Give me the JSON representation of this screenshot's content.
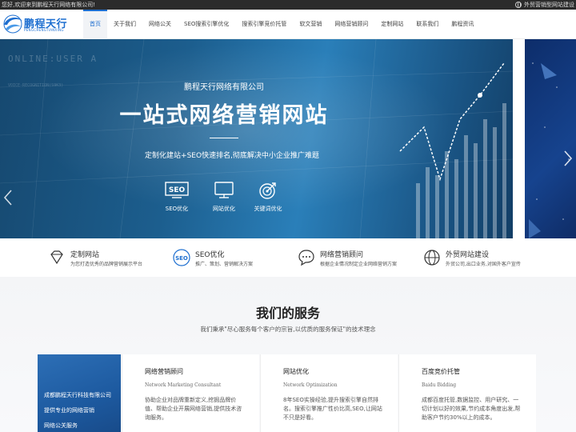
{
  "topbar": {
    "welcome": "您好,欢迎来到鹏程天行网络有限公司!",
    "right_link": "外贸营销型网站建设"
  },
  "logo": {
    "name": "鹏程天行",
    "sub": "PENGCHENGTIANXING"
  },
  "nav": {
    "items": [
      "首页",
      "关于我们",
      "网络公关",
      "SEO搜索引擎优化",
      "搜索引擎竞价托管",
      "软文营销",
      "网络营销顾问",
      "定制网站",
      "联系我们",
      "鹏程资讯"
    ],
    "active_index": 0
  },
  "banner": {
    "ghost_text": "ONLINE:USER A",
    "ghost_small": "VOICE-RECOGNITION(S9K3)",
    "company": "鹏程天行网络有限公司",
    "headline": "一站式网络营销网站",
    "tagline": "定制化建站+SEO快速排名,彻底解决中小企业推广难题",
    "features": [
      {
        "icon": "seo-icon",
        "label": "SEO优化"
      },
      {
        "icon": "monitor-icon",
        "label": "网站优化"
      },
      {
        "icon": "target-icon",
        "label": "关键词优化"
      }
    ],
    "slide_count": 2,
    "active_slide": 0
  },
  "features": [
    {
      "icon": "diamond-icon",
      "title": "定制网站",
      "desc": "为您打造优秀的品牌营销展示平台"
    },
    {
      "icon": "seo-icon",
      "title": "SEO优化",
      "desc": "推广、策划、营销解决方案"
    },
    {
      "icon": "chat-icon",
      "title": "网络营销顾问",
      "desc": "根据企业情况制定企业网络营销方案"
    },
    {
      "icon": "globe-icon",
      "title": "外贸网站建设",
      "desc": "外贸公司,出口业务,对国外客户宣传"
    }
  ],
  "services": {
    "title": "我们的服务",
    "subtitle": "我们秉承\"尽心服务每个客户的宗旨,以优质的服务保证\"的技术理念",
    "left_lines": [
      "成都鹏程天行科技有限公司",
      "提供专业的网络营销",
      "网络公关服务"
    ],
    "cards": [
      {
        "title": "网络营销顾问",
        "en": "Network Marketing Consultant",
        "desc": "协助企业对品牌重新定义,挖掘品牌价值、帮助企业开展网络营销,提供技术咨询服务。"
      },
      {
        "title": "网站优化",
        "en": "Network Optimization",
        "desc": "8年SEO实操经验,提升搜索引擎自然排名。搜索引擎推广性价比高,SEO,让网站不只是好看。"
      },
      {
        "title": "百度竞价托管",
        "en": "Baidu Bidding",
        "desc": "成都百度托管,数据监控、用户研究、一切计划以好的效果,节约成本角度出发,帮助客户节约30%以上的成本。"
      }
    ]
  }
}
